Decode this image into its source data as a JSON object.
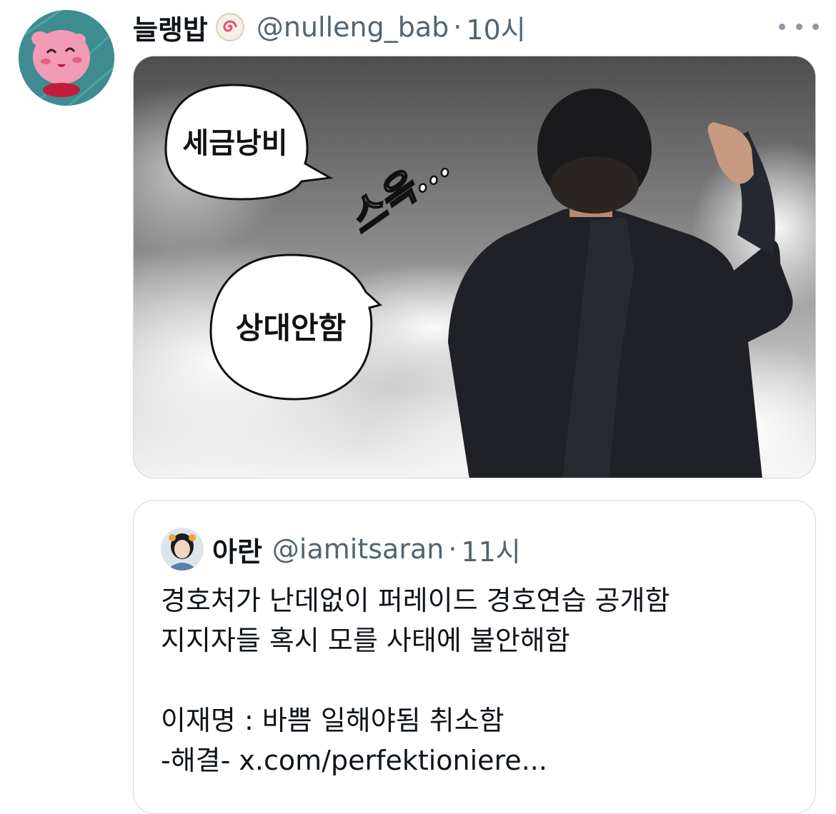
{
  "tweet": {
    "display_name": "늘랭밥",
    "name_emoji": "fishcake-emoji",
    "handle": "@nulleng_bab",
    "separator": "·",
    "time": "10시",
    "more_icon": "more-icon",
    "media": {
      "bubble_1": "세금낭비",
      "bubble_2": "상대안함",
      "sfx": "스윽..."
    }
  },
  "quote": {
    "display_name": "아란",
    "handle": "@iamitsaran",
    "separator": "·",
    "time": "11시",
    "lines": [
      "경호처가 난데없이 퍼레이드 경호연습 공개함",
      "지지자들 혹시 모를 사태에 불안해함",
      "",
      "이재명 : 바쁨 일해야됨 취소함",
      "-해결- x.com/perfektioniere..."
    ]
  },
  "colors": {
    "text_primary": "#0f1419",
    "text_secondary": "#536471",
    "border": "#cfd9de"
  }
}
